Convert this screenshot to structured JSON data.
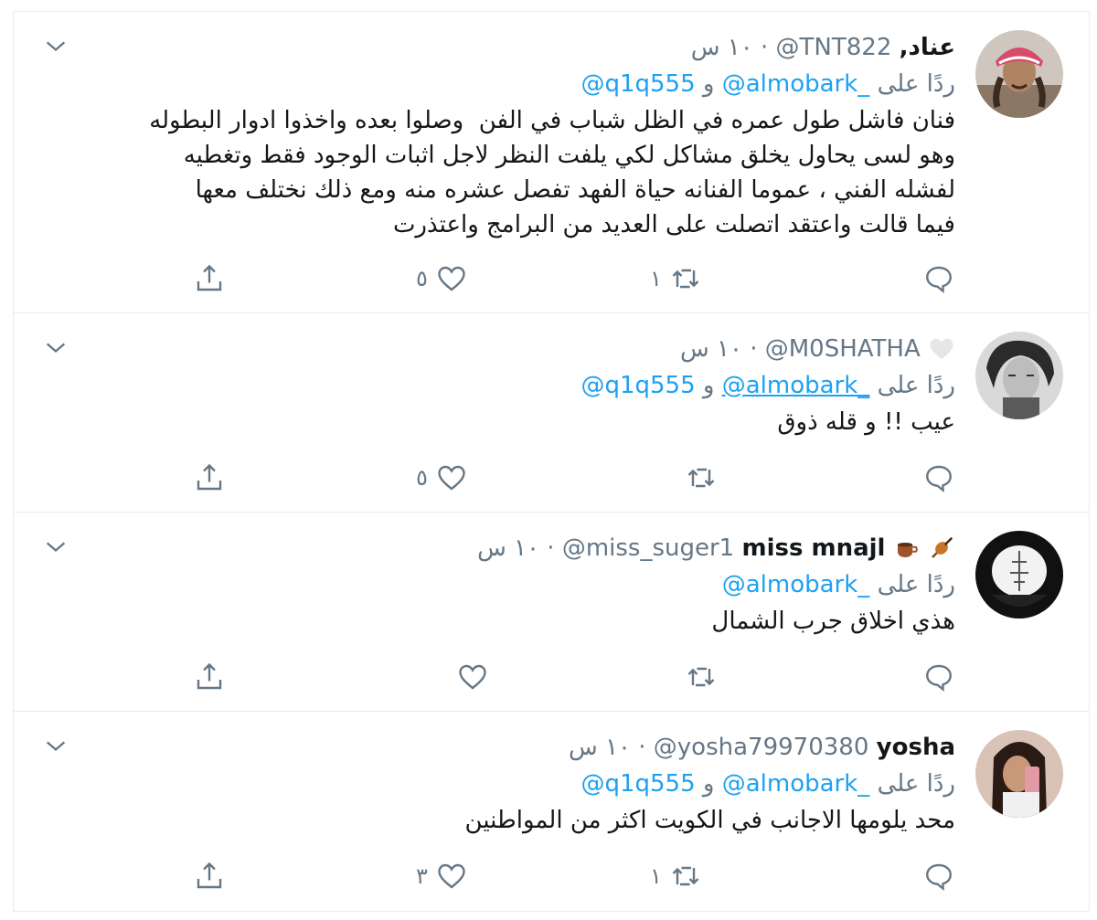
{
  "colors": {
    "link": "#1da1f2",
    "secondary_text": "#657786",
    "primary_text": "#14171a",
    "divider": "#e6ecf0"
  },
  "icons": {
    "reply": "speech-bubble-icon",
    "retweet": "retweet-icon",
    "like": "heart-icon",
    "share": "share-icon",
    "menu": "chevron-down-icon"
  },
  "tweets": [
    {
      "display_name": "عناد,",
      "handle": "@TNT822",
      "dot": "·",
      "time": "١٠ س",
      "reply_prefix": "ردًا على",
      "mention_1": "@almobark_",
      "reply_and": "و",
      "mention_2": "@q1q555",
      "text": "فنان فاشل طول عمره في الظل شباب في الفن  وصلوا بعده واخذوا ادوار البطوله\nوهو لسى يحاول يخلق مشاكل لكي يلفت النظر لاجل اثبات الوجود فقط وتغطيه\nلفشله الفني ، عموما الفنانه حياة الفهد تفصل عشره منه ومع ذلك نختلف معها\nفيما قالت واعتقد اتصلت على العديد من البرامج واعتذرت",
      "retweets": "١",
      "likes": "٥"
    },
    {
      "display_name": "",
      "handle": "@M0SHATHA",
      "dot": "·",
      "time": "١٠ س",
      "reply_prefix": "ردًا على",
      "mention_1": "@almobark_",
      "reply_and": "و",
      "mention_2": "@q1q555",
      "text": "عيب !! و قله ذوق",
      "retweets": "",
      "likes": "٥"
    },
    {
      "display_name": "miss mnajl",
      "handle": "@miss_suger1",
      "dot": "·",
      "time": "١٠ س",
      "reply_prefix": "ردًا على",
      "mention_1": "@almobark_",
      "text": "هذي اخلاق جرب الشمال",
      "retweets": "",
      "likes": ""
    },
    {
      "display_name": "yosha",
      "handle": "@yosha79970380",
      "dot": "·",
      "time": "١٠ س",
      "reply_prefix": "ردًا على",
      "mention_1": "@almobark_",
      "reply_and": "و",
      "mention_2": "@q1q555",
      "text": "محد يلومها الاجانب في الكويت اكثر من المواطنين",
      "retweets": "١",
      "likes": "٣"
    }
  ]
}
